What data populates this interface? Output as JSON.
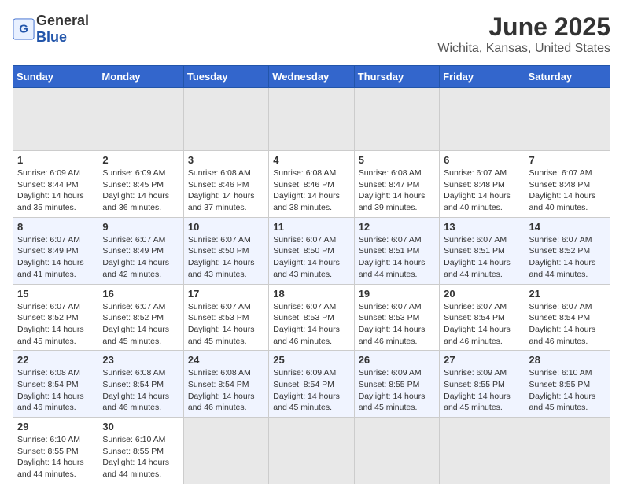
{
  "header": {
    "logo_general": "General",
    "logo_blue": "Blue",
    "title": "June 2025",
    "subtitle": "Wichita, Kansas, United States"
  },
  "calendar": {
    "weekdays": [
      "Sunday",
      "Monday",
      "Tuesday",
      "Wednesday",
      "Thursday",
      "Friday",
      "Saturday"
    ],
    "weeks": [
      [
        {
          "day": "",
          "empty": true
        },
        {
          "day": "",
          "empty": true
        },
        {
          "day": "",
          "empty": true
        },
        {
          "day": "",
          "empty": true
        },
        {
          "day": "",
          "empty": true
        },
        {
          "day": "",
          "empty": true
        },
        {
          "day": "",
          "empty": true
        }
      ],
      [
        {
          "day": "1",
          "sunrise": "6:09 AM",
          "sunset": "8:44 PM",
          "daylight": "14 hours and 35 minutes."
        },
        {
          "day": "2",
          "sunrise": "6:09 AM",
          "sunset": "8:45 PM",
          "daylight": "14 hours and 36 minutes."
        },
        {
          "day": "3",
          "sunrise": "6:08 AM",
          "sunset": "8:46 PM",
          "daylight": "14 hours and 37 minutes."
        },
        {
          "day": "4",
          "sunrise": "6:08 AM",
          "sunset": "8:46 PM",
          "daylight": "14 hours and 38 minutes."
        },
        {
          "day": "5",
          "sunrise": "6:08 AM",
          "sunset": "8:47 PM",
          "daylight": "14 hours and 39 minutes."
        },
        {
          "day": "6",
          "sunrise": "6:07 AM",
          "sunset": "8:48 PM",
          "daylight": "14 hours and 40 minutes."
        },
        {
          "day": "7",
          "sunrise": "6:07 AM",
          "sunset": "8:48 PM",
          "daylight": "14 hours and 40 minutes."
        }
      ],
      [
        {
          "day": "8",
          "sunrise": "6:07 AM",
          "sunset": "8:49 PM",
          "daylight": "14 hours and 41 minutes."
        },
        {
          "day": "9",
          "sunrise": "6:07 AM",
          "sunset": "8:49 PM",
          "daylight": "14 hours and 42 minutes."
        },
        {
          "day": "10",
          "sunrise": "6:07 AM",
          "sunset": "8:50 PM",
          "daylight": "14 hours and 43 minutes."
        },
        {
          "day": "11",
          "sunrise": "6:07 AM",
          "sunset": "8:50 PM",
          "daylight": "14 hours and 43 minutes."
        },
        {
          "day": "12",
          "sunrise": "6:07 AM",
          "sunset": "8:51 PM",
          "daylight": "14 hours and 44 minutes."
        },
        {
          "day": "13",
          "sunrise": "6:07 AM",
          "sunset": "8:51 PM",
          "daylight": "14 hours and 44 minutes."
        },
        {
          "day": "14",
          "sunrise": "6:07 AM",
          "sunset": "8:52 PM",
          "daylight": "14 hours and 44 minutes."
        }
      ],
      [
        {
          "day": "15",
          "sunrise": "6:07 AM",
          "sunset": "8:52 PM",
          "daylight": "14 hours and 45 minutes."
        },
        {
          "day": "16",
          "sunrise": "6:07 AM",
          "sunset": "8:52 PM",
          "daylight": "14 hours and 45 minutes."
        },
        {
          "day": "17",
          "sunrise": "6:07 AM",
          "sunset": "8:53 PM",
          "daylight": "14 hours and 45 minutes."
        },
        {
          "day": "18",
          "sunrise": "6:07 AM",
          "sunset": "8:53 PM",
          "daylight": "14 hours and 46 minutes."
        },
        {
          "day": "19",
          "sunrise": "6:07 AM",
          "sunset": "8:53 PM",
          "daylight": "14 hours and 46 minutes."
        },
        {
          "day": "20",
          "sunrise": "6:07 AM",
          "sunset": "8:54 PM",
          "daylight": "14 hours and 46 minutes."
        },
        {
          "day": "21",
          "sunrise": "6:07 AM",
          "sunset": "8:54 PM",
          "daylight": "14 hours and 46 minutes."
        }
      ],
      [
        {
          "day": "22",
          "sunrise": "6:08 AM",
          "sunset": "8:54 PM",
          "daylight": "14 hours and 46 minutes."
        },
        {
          "day": "23",
          "sunrise": "6:08 AM",
          "sunset": "8:54 PM",
          "daylight": "14 hours and 46 minutes."
        },
        {
          "day": "24",
          "sunrise": "6:08 AM",
          "sunset": "8:54 PM",
          "daylight": "14 hours and 46 minutes."
        },
        {
          "day": "25",
          "sunrise": "6:09 AM",
          "sunset": "8:54 PM",
          "daylight": "14 hours and 45 minutes."
        },
        {
          "day": "26",
          "sunrise": "6:09 AM",
          "sunset": "8:55 PM",
          "daylight": "14 hours and 45 minutes."
        },
        {
          "day": "27",
          "sunrise": "6:09 AM",
          "sunset": "8:55 PM",
          "daylight": "14 hours and 45 minutes."
        },
        {
          "day": "28",
          "sunrise": "6:10 AM",
          "sunset": "8:55 PM",
          "daylight": "14 hours and 45 minutes."
        }
      ],
      [
        {
          "day": "29",
          "sunrise": "6:10 AM",
          "sunset": "8:55 PM",
          "daylight": "14 hours and 44 minutes."
        },
        {
          "day": "30",
          "sunrise": "6:10 AM",
          "sunset": "8:55 PM",
          "daylight": "14 hours and 44 minutes."
        },
        {
          "day": "",
          "empty": true
        },
        {
          "day": "",
          "empty": true
        },
        {
          "day": "",
          "empty": true
        },
        {
          "day": "",
          "empty": true
        },
        {
          "day": "",
          "empty": true
        }
      ]
    ]
  }
}
